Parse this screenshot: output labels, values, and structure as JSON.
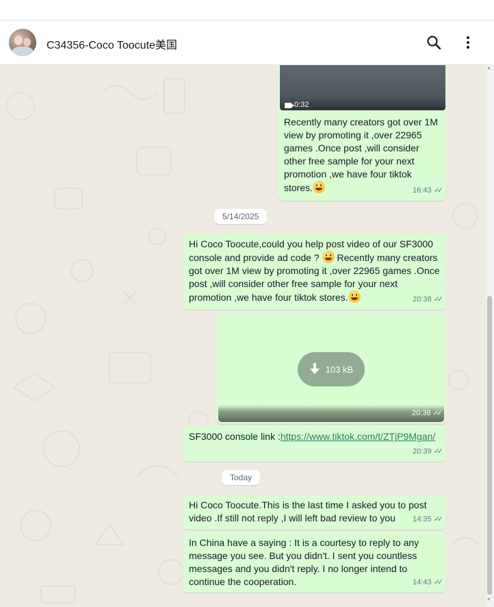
{
  "contact": {
    "name": "C34356-Coco Toocute美国"
  },
  "header": {
    "search_icon": "search-icon",
    "menu_icon": "kebab-menu-icon"
  },
  "messages": [
    {
      "type": "video",
      "duration": "0:32",
      "text": "Recently many creators got over 1M view by promoting it ,over 22965 games .Once post ,will consider other free sample for your next promotion ,we have four tiktok stores.",
      "time": "16:43",
      "status": "read"
    },
    {
      "type": "date",
      "label": "5/14/2025"
    },
    {
      "type": "text",
      "text_part1": "Hi Coco Toocute,could you help post video of our SF3000 console and provide ad code ?",
      "text_part2": "Recently many creators got over 1M view by promoting it ,over 22965 games .Once post ,will consider other free sample for your next promotion ,we have four tiktok stores.",
      "time": "20:38",
      "status": "read"
    },
    {
      "type": "image",
      "size": "103 kB",
      "time": "20:38",
      "status": "read"
    },
    {
      "type": "text",
      "text": "SF3000 console link :",
      "link": "https://www.tiktok.com/t/ZTjP9Mgan/",
      "time": "20:39",
      "status": "read"
    },
    {
      "type": "date",
      "label": "Today"
    },
    {
      "type": "text",
      "text": "Hi Coco Toocute.This is the last time I asked you to post video .If still not reply ,I will left bad review to you",
      "time": "14:35",
      "status": "read"
    },
    {
      "type": "text",
      "text": "In China have a saying : It is a courtesy to reply to any message you see. But you didn't. I sent you countless messages and you didn't reply. I no longer intend to continue the cooperation.",
      "time": "14:43",
      "status": "read"
    }
  ],
  "ticks_glyph": "✓✓",
  "colors": {
    "outgoing_bubble": "#d9fdd3",
    "chat_background": "#efeae2",
    "meta_text": "#667781",
    "link": "#2d7d5a"
  }
}
